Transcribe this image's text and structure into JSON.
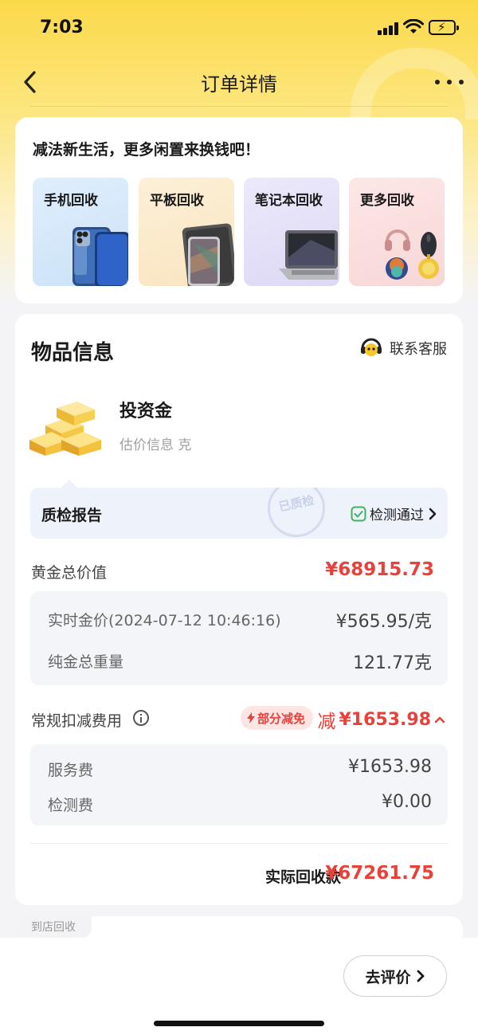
{
  "status_bar": {
    "time": "7:03"
  },
  "nav": {
    "title": "订单详情"
  },
  "promo": {
    "title": "减法新生活，更多闲置来换钱吧！",
    "tiles": [
      {
        "label": "手机回收",
        "icon": "phone-image"
      },
      {
        "label": "平板回收",
        "icon": "tablet-image"
      },
      {
        "label": "笔记本回收",
        "icon": "laptop-image"
      },
      {
        "label": "更多回收",
        "icon": "devices-image"
      }
    ]
  },
  "item_info": {
    "section_title": "物品信息",
    "service_label": "联系客服",
    "product_name": "投资金",
    "product_sub": "估价信息 克",
    "qc": {
      "title": "质检报告",
      "stamp_text": "已质检",
      "pass_label": "检测通过"
    },
    "gold_total": {
      "label": "黄金总价值",
      "value": "¥68915.73"
    },
    "price_details": [
      {
        "label": "实时金价(2024-07-12 10:46:16)",
        "value": "¥565.95/克"
      },
      {
        "label": "纯金总重量",
        "value": "121.77克"
      }
    ],
    "deductions": {
      "label": "常规扣减费用",
      "badge": "部分减免",
      "prefix": "减",
      "value": "¥1653.98",
      "items": [
        {
          "label": "服务费",
          "value": "¥1653.98"
        },
        {
          "label": "检测费",
          "value": "¥0.00"
        }
      ]
    },
    "actual": {
      "label": "实际回收款",
      "value": "¥67261.75"
    }
  },
  "store": {
    "tag": "到店回收"
  },
  "bottom": {
    "review_label": "去评价"
  },
  "colors": {
    "accent_red": "#e8413a",
    "header_yellow": "#fbd94a",
    "pass_green": "#3cb55e"
  }
}
